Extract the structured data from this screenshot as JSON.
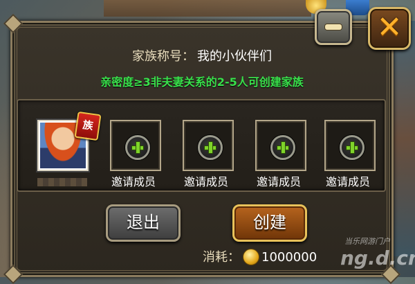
{
  "dialog": {
    "title_label": "家族称号：",
    "title_value": "我的小伙伴们",
    "hint": "亲密度≥3非夫妻关系的2-5人可创建家族"
  },
  "members": {
    "leader_badge": "族",
    "slots": [
      {
        "label": "邀请成员"
      },
      {
        "label": "邀请成员"
      },
      {
        "label": "邀请成员"
      },
      {
        "label": "邀请成员"
      }
    ]
  },
  "buttons": {
    "exit_label": "退出",
    "create_label": "创建",
    "minimize_icon": "minus-icon",
    "close_icon": "close-icon"
  },
  "cost": {
    "label": "消耗：",
    "icon": "gold-coin-icon",
    "amount": "1000000"
  },
  "watermark": {
    "line1": "当乐网游门户",
    "line2": "ng.d.cn"
  },
  "colors": {
    "hint_green": "#39e04b",
    "plus_green": "#7fd42a",
    "close_orange": "#ffb12a"
  }
}
